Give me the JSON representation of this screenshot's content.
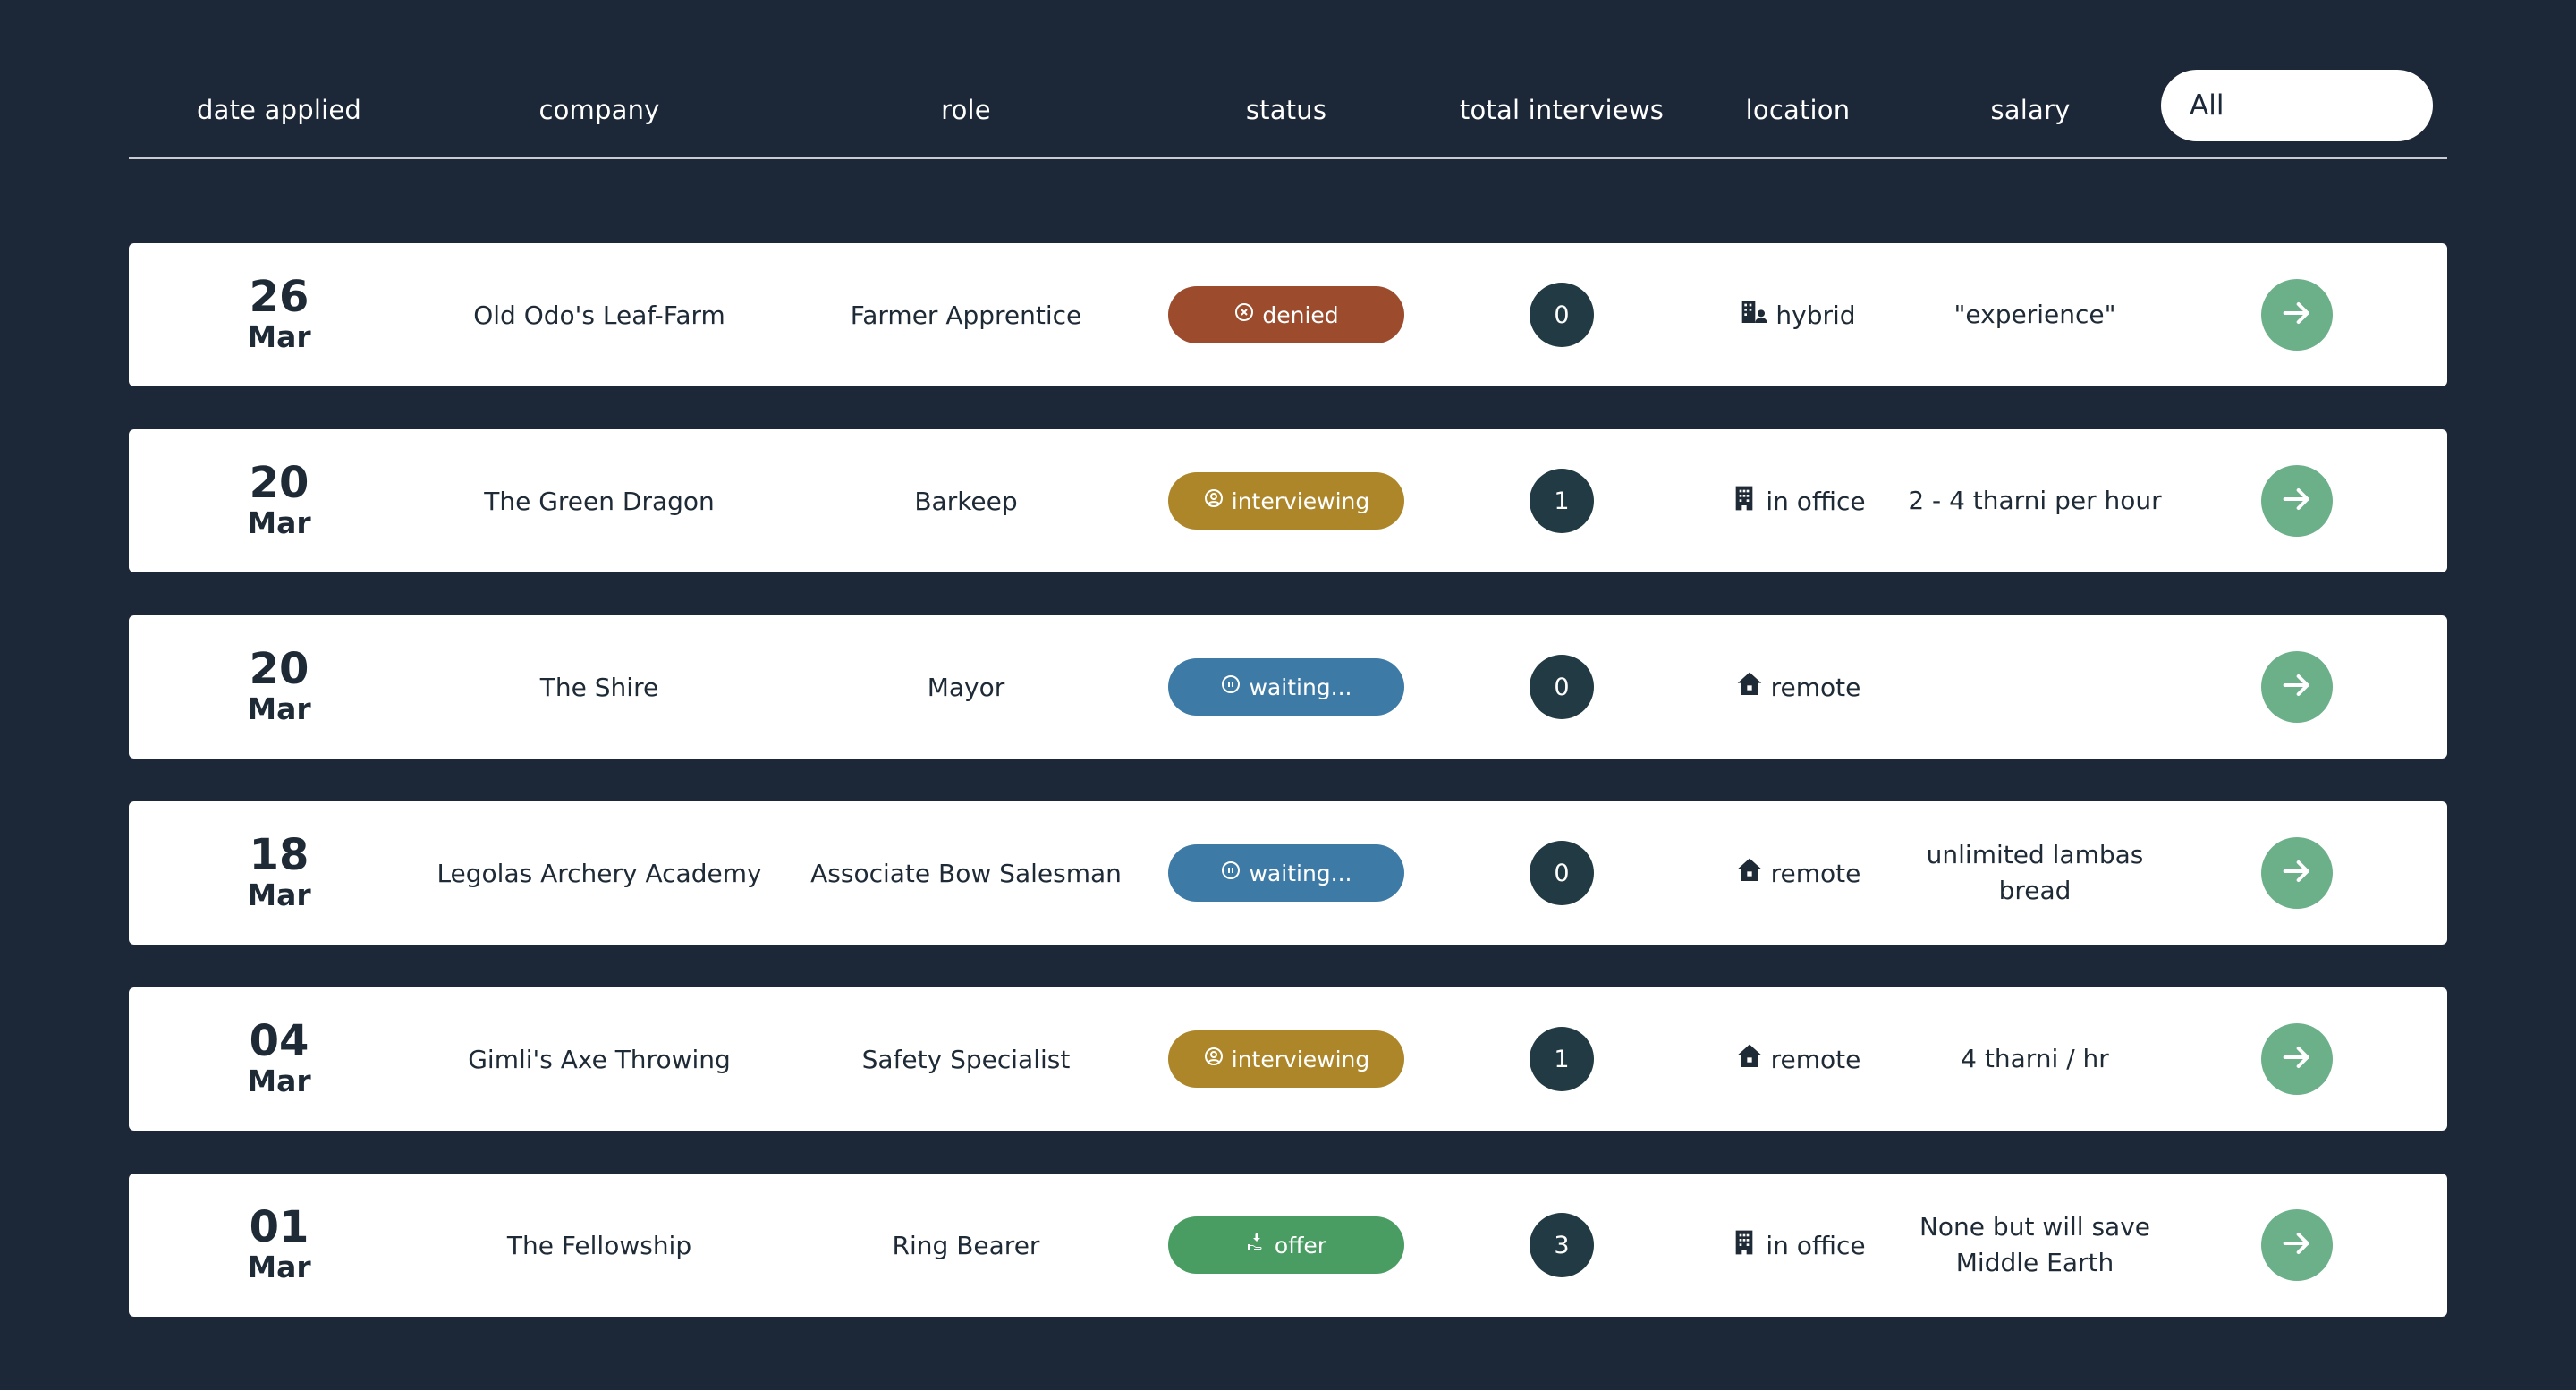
{
  "colors": {
    "background": "#1c2738",
    "denied": "#9c4b2d",
    "interviewing": "#ad8629",
    "waiting": "#3d7aa6",
    "offer": "#4a9d62",
    "count_badge": "#213a44",
    "go_button": "#6cb08a"
  },
  "header": {
    "date_applied": "date applied",
    "company": "company",
    "role": "role",
    "status": "status",
    "total_interviews": "total interviews",
    "location": "location",
    "salary": "salary",
    "filter_value": "All"
  },
  "rows": [
    {
      "day": "26",
      "month": "Mar",
      "company": "Old Odo's Leaf-Farm",
      "role": "Farmer Apprentice",
      "status": "denied",
      "status_type": "denied",
      "status_icon": "x-circle-icon",
      "interviews": "0",
      "location": "hybrid",
      "location_icon": "building-person-icon",
      "salary": "\"experience\""
    },
    {
      "day": "20",
      "month": "Mar",
      "company": "The Green Dragon",
      "role": "Barkeep",
      "status": "interviewing",
      "status_type": "interviewing",
      "status_icon": "person-circle-icon",
      "interviews": "1",
      "location": "in office",
      "location_icon": "building-icon",
      "salary": "2 - 4 tharni per hour"
    },
    {
      "day": "20",
      "month": "Mar",
      "company": "The Shire",
      "role": "Mayor",
      "status": "waiting...",
      "status_type": "waiting",
      "status_icon": "pause-circle-icon",
      "interviews": "0",
      "location": "remote",
      "location_icon": "house-icon",
      "salary": ""
    },
    {
      "day": "18",
      "month": "Mar",
      "company": "Legolas Archery Academy",
      "role": "Associate Bow Salesman",
      "status": "waiting...",
      "status_type": "waiting",
      "status_icon": "pause-circle-icon",
      "interviews": "0",
      "location": "remote",
      "location_icon": "house-icon",
      "salary": "unlimited lambas bread"
    },
    {
      "day": "04",
      "month": "Mar",
      "company": "Gimli's Axe Throwing",
      "role": "Safety Specialist",
      "status": "interviewing",
      "status_type": "interviewing",
      "status_icon": "person-circle-icon",
      "interviews": "1",
      "location": "remote",
      "location_icon": "house-icon",
      "salary": "4 tharni / hr"
    },
    {
      "day": "01",
      "month": "Mar",
      "company": "The Fellowship",
      "role": "Ring Bearer",
      "status": "offer",
      "status_type": "offer",
      "status_icon": "hand-offer-icon",
      "interviews": "3",
      "location": "in office",
      "location_icon": "building-icon",
      "salary": "None but will save Middle Earth"
    }
  ]
}
